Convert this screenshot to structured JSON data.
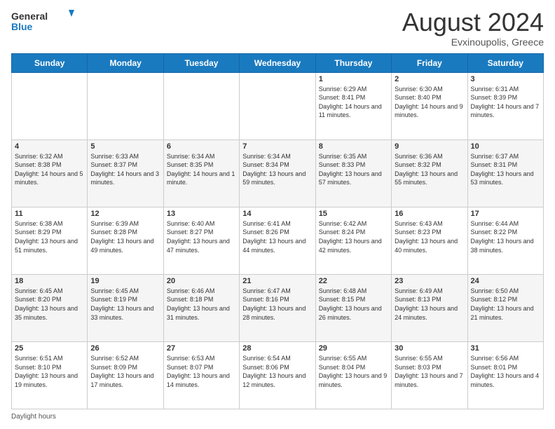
{
  "header": {
    "logo_general": "General",
    "logo_blue": "Blue",
    "month_title": "August 2024",
    "location": "Evxinoupolis, Greece"
  },
  "days_of_week": [
    "Sunday",
    "Monday",
    "Tuesday",
    "Wednesday",
    "Thursday",
    "Friday",
    "Saturday"
  ],
  "weeks": [
    [
      {
        "day": "",
        "info": ""
      },
      {
        "day": "",
        "info": ""
      },
      {
        "day": "",
        "info": ""
      },
      {
        "day": "",
        "info": ""
      },
      {
        "day": "1",
        "info": "Sunrise: 6:29 AM\nSunset: 8:41 PM\nDaylight: 14 hours\nand 11 minutes."
      },
      {
        "day": "2",
        "info": "Sunrise: 6:30 AM\nSunset: 8:40 PM\nDaylight: 14 hours\nand 9 minutes."
      },
      {
        "day": "3",
        "info": "Sunrise: 6:31 AM\nSunset: 8:39 PM\nDaylight: 14 hours\nand 7 minutes."
      }
    ],
    [
      {
        "day": "4",
        "info": "Sunrise: 6:32 AM\nSunset: 8:38 PM\nDaylight: 14 hours\nand 5 minutes."
      },
      {
        "day": "5",
        "info": "Sunrise: 6:33 AM\nSunset: 8:37 PM\nDaylight: 14 hours\nand 3 minutes."
      },
      {
        "day": "6",
        "info": "Sunrise: 6:34 AM\nSunset: 8:35 PM\nDaylight: 14 hours\nand 1 minute."
      },
      {
        "day": "7",
        "info": "Sunrise: 6:34 AM\nSunset: 8:34 PM\nDaylight: 13 hours\nand 59 minutes."
      },
      {
        "day": "8",
        "info": "Sunrise: 6:35 AM\nSunset: 8:33 PM\nDaylight: 13 hours\nand 57 minutes."
      },
      {
        "day": "9",
        "info": "Sunrise: 6:36 AM\nSunset: 8:32 PM\nDaylight: 13 hours\nand 55 minutes."
      },
      {
        "day": "10",
        "info": "Sunrise: 6:37 AM\nSunset: 8:31 PM\nDaylight: 13 hours\nand 53 minutes."
      }
    ],
    [
      {
        "day": "11",
        "info": "Sunrise: 6:38 AM\nSunset: 8:29 PM\nDaylight: 13 hours\nand 51 minutes."
      },
      {
        "day": "12",
        "info": "Sunrise: 6:39 AM\nSunset: 8:28 PM\nDaylight: 13 hours\nand 49 minutes."
      },
      {
        "day": "13",
        "info": "Sunrise: 6:40 AM\nSunset: 8:27 PM\nDaylight: 13 hours\nand 47 minutes."
      },
      {
        "day": "14",
        "info": "Sunrise: 6:41 AM\nSunset: 8:26 PM\nDaylight: 13 hours\nand 44 minutes."
      },
      {
        "day": "15",
        "info": "Sunrise: 6:42 AM\nSunset: 8:24 PM\nDaylight: 13 hours\nand 42 minutes."
      },
      {
        "day": "16",
        "info": "Sunrise: 6:43 AM\nSunset: 8:23 PM\nDaylight: 13 hours\nand 40 minutes."
      },
      {
        "day": "17",
        "info": "Sunrise: 6:44 AM\nSunset: 8:22 PM\nDaylight: 13 hours\nand 38 minutes."
      }
    ],
    [
      {
        "day": "18",
        "info": "Sunrise: 6:45 AM\nSunset: 8:20 PM\nDaylight: 13 hours\nand 35 minutes."
      },
      {
        "day": "19",
        "info": "Sunrise: 6:45 AM\nSunset: 8:19 PM\nDaylight: 13 hours\nand 33 minutes."
      },
      {
        "day": "20",
        "info": "Sunrise: 6:46 AM\nSunset: 8:18 PM\nDaylight: 13 hours\nand 31 minutes."
      },
      {
        "day": "21",
        "info": "Sunrise: 6:47 AM\nSunset: 8:16 PM\nDaylight: 13 hours\nand 28 minutes."
      },
      {
        "day": "22",
        "info": "Sunrise: 6:48 AM\nSunset: 8:15 PM\nDaylight: 13 hours\nand 26 minutes."
      },
      {
        "day": "23",
        "info": "Sunrise: 6:49 AM\nSunset: 8:13 PM\nDaylight: 13 hours\nand 24 minutes."
      },
      {
        "day": "24",
        "info": "Sunrise: 6:50 AM\nSunset: 8:12 PM\nDaylight: 13 hours\nand 21 minutes."
      }
    ],
    [
      {
        "day": "25",
        "info": "Sunrise: 6:51 AM\nSunset: 8:10 PM\nDaylight: 13 hours\nand 19 minutes."
      },
      {
        "day": "26",
        "info": "Sunrise: 6:52 AM\nSunset: 8:09 PM\nDaylight: 13 hours\nand 17 minutes."
      },
      {
        "day": "27",
        "info": "Sunrise: 6:53 AM\nSunset: 8:07 PM\nDaylight: 13 hours\nand 14 minutes."
      },
      {
        "day": "28",
        "info": "Sunrise: 6:54 AM\nSunset: 8:06 PM\nDaylight: 13 hours\nand 12 minutes."
      },
      {
        "day": "29",
        "info": "Sunrise: 6:55 AM\nSunset: 8:04 PM\nDaylight: 13 hours\nand 9 minutes."
      },
      {
        "day": "30",
        "info": "Sunrise: 6:55 AM\nSunset: 8:03 PM\nDaylight: 13 hours\nand 7 minutes."
      },
      {
        "day": "31",
        "info": "Sunrise: 6:56 AM\nSunset: 8:01 PM\nDaylight: 13 hours\nand 4 minutes."
      }
    ]
  ],
  "footer": {
    "daylight_hours": "Daylight hours"
  },
  "colors": {
    "header_bg": "#1a7abf",
    "accent": "#1a7abf"
  }
}
